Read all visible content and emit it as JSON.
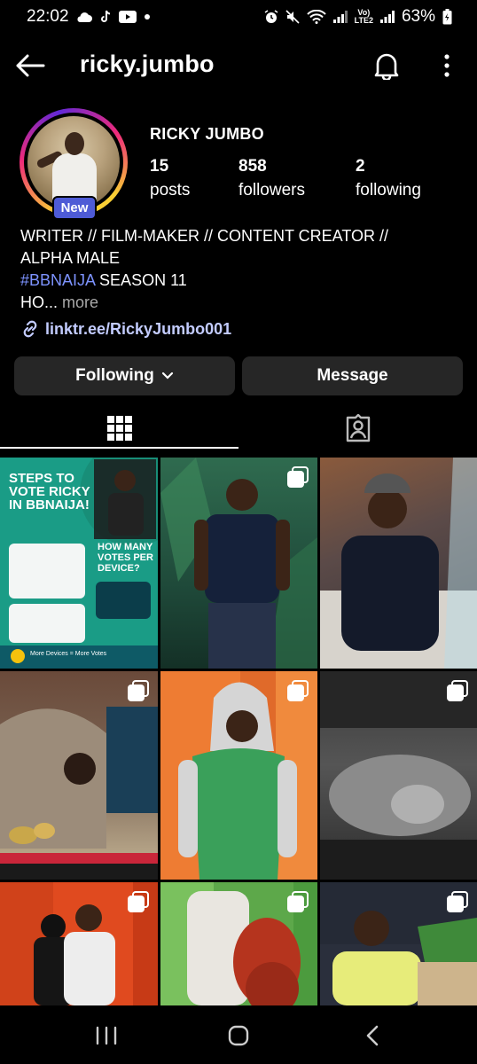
{
  "status_bar": {
    "time": "22:02",
    "network_top": "Vo)",
    "network_bottom": "LTE2",
    "battery": "63%"
  },
  "header": {
    "username": "ricky.jumbo",
    "icons": [
      "back-arrow-icon",
      "bell-icon",
      "more-vertical-icon"
    ]
  },
  "profile": {
    "badge": "New",
    "display_name": "RICKY JUMBO",
    "stats": [
      {
        "value": "15",
        "label": "posts"
      },
      {
        "value": "858",
        "label": "followers"
      },
      {
        "value": "2",
        "label": "following"
      }
    ],
    "bio": {
      "line1": "WRITER // FILM-MAKER // CONTENT CREATOR //",
      "line2": "ALPHA MALE",
      "hashtag": "#BBNAIJA",
      "line3_rest": " SEASON 11",
      "line4_start": "HO...",
      "more": "more"
    },
    "link": "linktr.ee/RickyJumbo001"
  },
  "actions": {
    "following": "Following",
    "message": "Message"
  },
  "tabs": [
    "grid-icon",
    "tagged-icon"
  ],
  "posts": [
    {
      "kind": "graphic",
      "title_lines": [
        "STEPS TO",
        "VOTE RICKY",
        "IN BBNAIJA!"
      ],
      "side_title_lines": [
        "HOW MANY",
        "VOTES PER",
        "DEVICE?"
      ],
      "footer": "More Devices = More Votes",
      "multi": false
    },
    {
      "kind": "photo",
      "multi": true
    },
    {
      "kind": "photo",
      "multi": false
    },
    {
      "kind": "photo",
      "multi": true
    },
    {
      "kind": "photo",
      "multi": true
    },
    {
      "kind": "photo",
      "multi": true
    },
    {
      "kind": "photo",
      "multi": true
    },
    {
      "kind": "photo",
      "multi": true
    },
    {
      "kind": "photo",
      "multi": true
    }
  ],
  "nav": [
    "recents-icon",
    "home-icon",
    "back-icon"
  ],
  "colors": {
    "background": "#000000",
    "button": "#262626",
    "link": "#c3ccff",
    "hashtag": "#7d93ff",
    "badge": "#4e5bd6"
  }
}
